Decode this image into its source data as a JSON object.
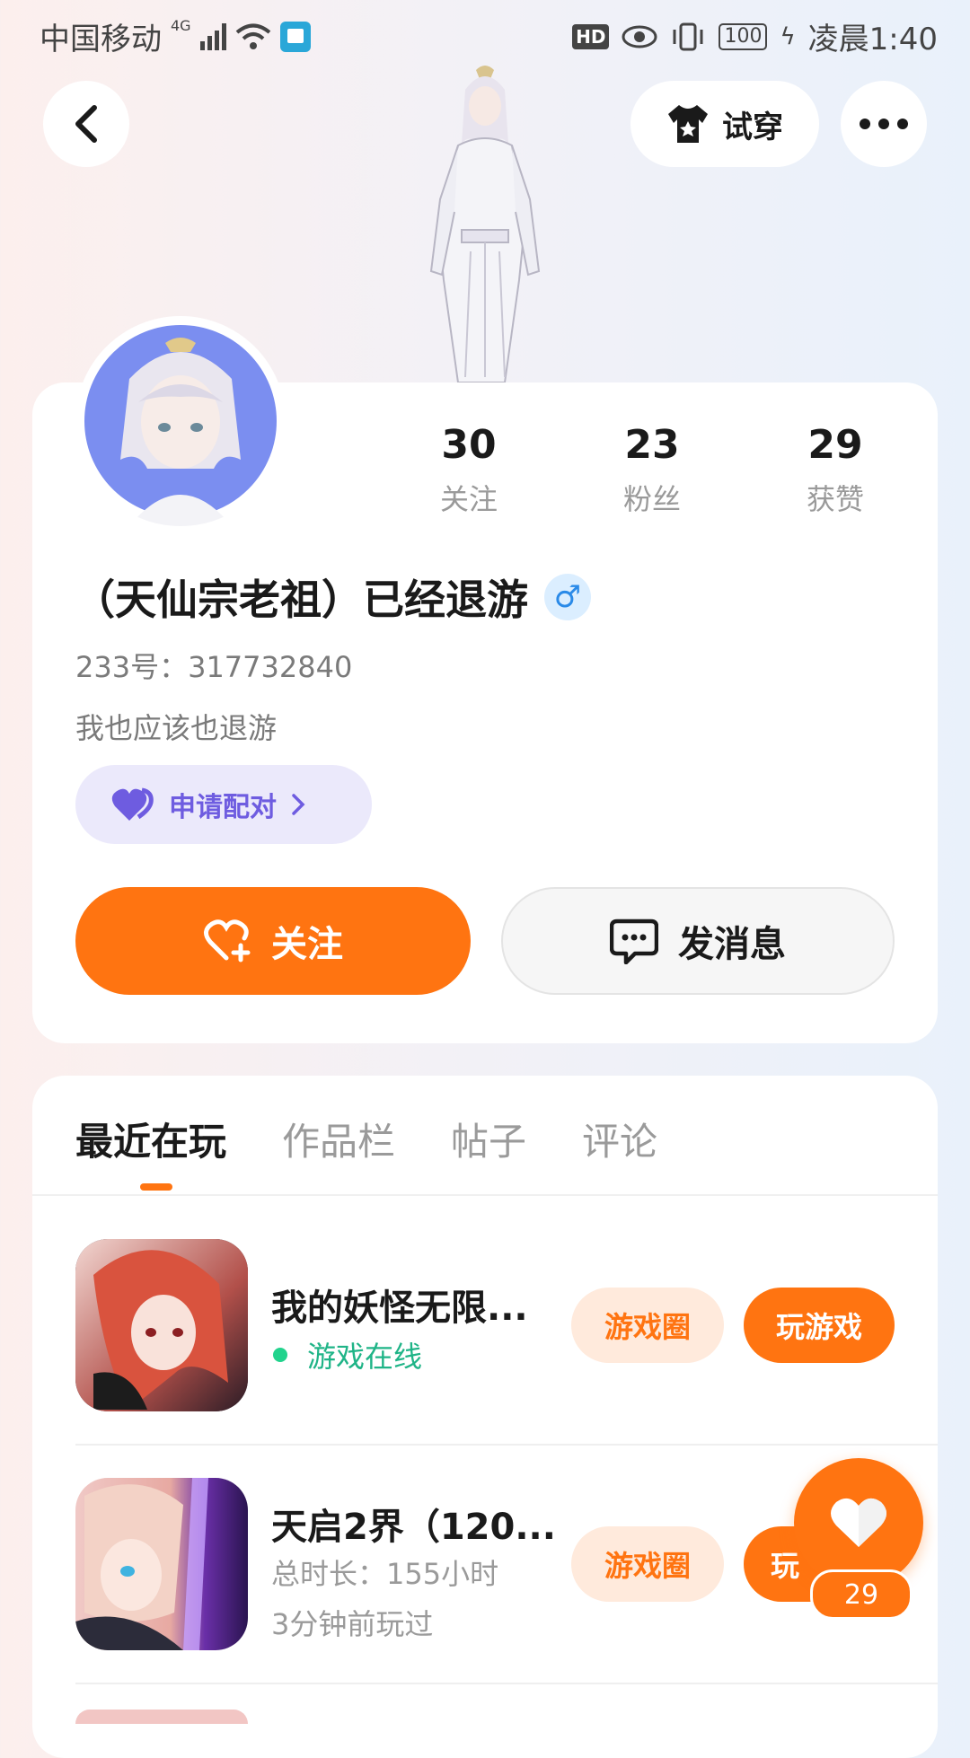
{
  "status_bar": {
    "carrier": "中国移动",
    "network": "4G",
    "hd": "HD",
    "battery": "100",
    "time": "凌晨1:40"
  },
  "header": {
    "tryon_label": "试穿"
  },
  "profile": {
    "stats": [
      {
        "value": "30",
        "label": "关注"
      },
      {
        "value": "23",
        "label": "粉丝"
      },
      {
        "value": "29",
        "label": "获赞"
      }
    ],
    "name": "（天仙宗老祖）已经退游",
    "gender_symbol": "♂",
    "uid": "233号：317732840",
    "bio": "我也应该也退游",
    "pair_label": "申请配对",
    "follow_label": "关注",
    "message_label": "发消息"
  },
  "tabs": [
    "最近在玩",
    "作品栏",
    "帖子",
    "评论"
  ],
  "games": [
    {
      "title": "我的妖怪无限...",
      "online_text": "游戏在线",
      "circle_label": "游戏圈",
      "play_label": "玩游戏"
    },
    {
      "title": "天启2界（120...",
      "duration": "总时长：155小时",
      "last_played": "3分钟前玩过",
      "circle_label": "游戏圈",
      "play_label": "玩"
    }
  ],
  "fab": {
    "count": "29"
  },
  "colors": {
    "accent": "#ff7411",
    "online": "#1fb487",
    "pair": "#6e5ce0"
  }
}
